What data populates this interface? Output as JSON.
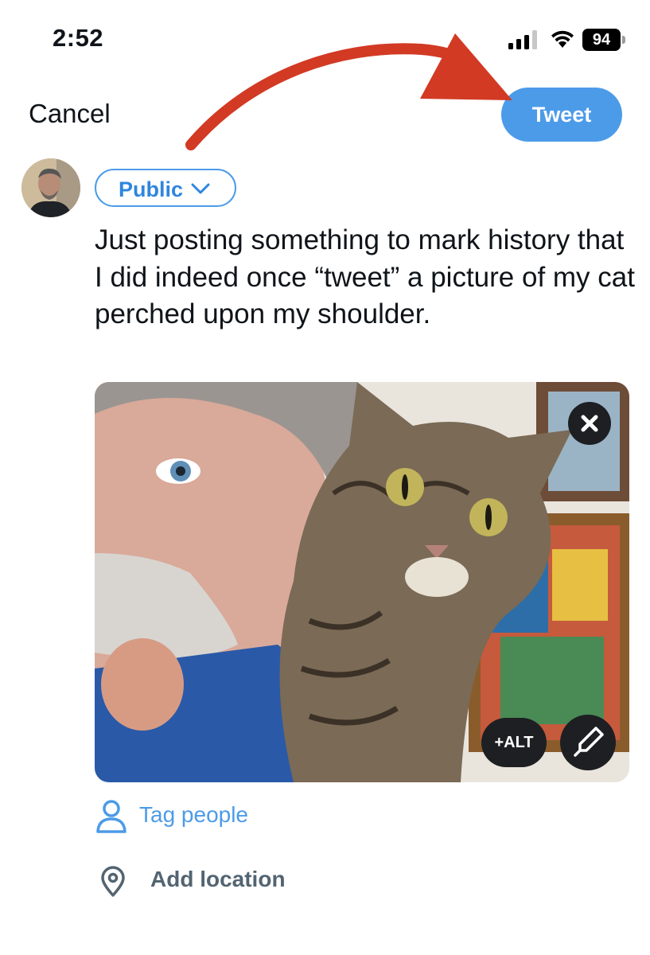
{
  "status_bar": {
    "time": "2:52",
    "battery": "94"
  },
  "header": {
    "cancel_label": "Cancel",
    "tweet_label": "Tweet"
  },
  "composer": {
    "audience_label": "Public",
    "text": "Just posting something to mark history that I did indeed once “tweet” a picture of my cat perched upon my shoulder."
  },
  "media": {
    "alt_label": "+ALT"
  },
  "actions": {
    "tag_people_label": "Tag people",
    "add_location_label": "Add location"
  },
  "icons": [
    "signal-icon",
    "wifi-icon",
    "battery-icon",
    "chevron-down-icon",
    "close-icon",
    "pencil-icon",
    "person-icon",
    "location-pin-icon",
    "arrow-annotation"
  ],
  "colors": {
    "accent": "#4c9be8",
    "annotation_arrow": "#d23a24",
    "text": "#0f1419",
    "muted": "#536471"
  }
}
